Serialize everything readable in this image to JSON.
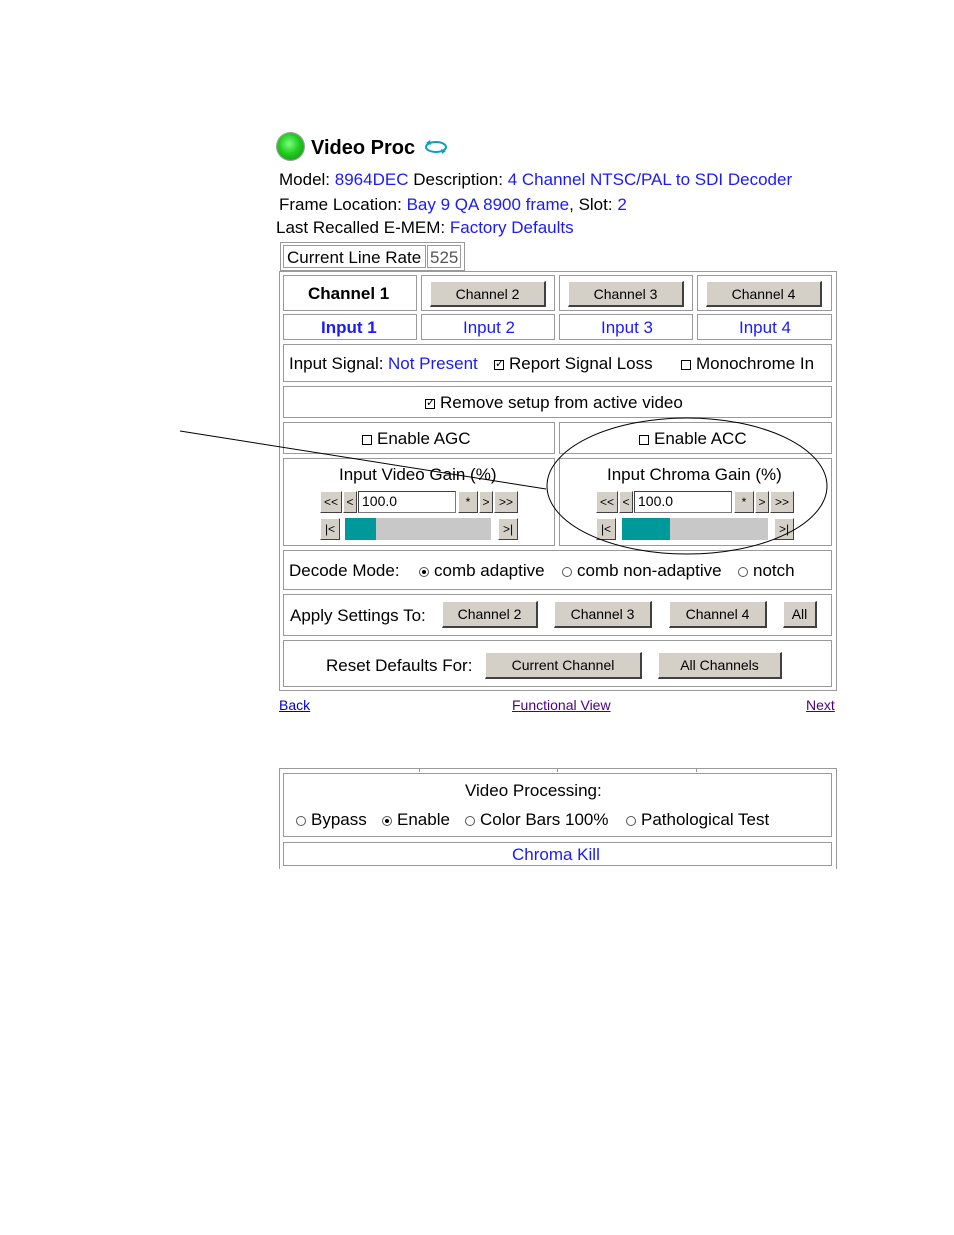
{
  "header": {
    "title": "Video Proc",
    "model_label": "Model:",
    "model_value": "8964DEC",
    "description_label": "Description:",
    "description_value": "4 Channel NTSC/PAL to SDI Decoder",
    "frame_location_label": "Frame Location:",
    "frame_location_value": "Bay 9 QA 8900 frame",
    "slot_label": ", Slot:",
    "slot_value": "2",
    "emem_label": "Last Recalled E-MEM:",
    "emem_value": "Factory Defaults"
  },
  "line_rate": {
    "label": "Current Line Rate",
    "value": "525"
  },
  "channels": {
    "current": "Channel 1",
    "buttons": [
      "Channel 2",
      "Channel 3",
      "Channel 4"
    ]
  },
  "inputs": [
    "Input 1",
    "Input 2",
    "Input 3",
    "Input 4"
  ],
  "input_signal": {
    "label": "Input Signal:",
    "value": "Not Present",
    "report_signal_loss": "Report Signal Loss",
    "report_signal_loss_checked": true,
    "monochrome": "Monochrome In",
    "monochrome_checked": false
  },
  "remove_setup": {
    "label": "Remove setup from active video",
    "checked": true
  },
  "agc": {
    "label": "Enable AGC",
    "checked": false
  },
  "acc": {
    "label": "Enable ACC",
    "checked": false
  },
  "video_gain": {
    "title": "Input Video Gain (%)",
    "value": "100.0",
    "level_fraction": 0.21,
    "btn_ll": "<<",
    "btn_l": "<",
    "btn_star": "*",
    "btn_r": ">",
    "btn_rr": ">>",
    "btn_min": "|<",
    "btn_max": ">|"
  },
  "chroma_gain": {
    "title": "Input Chroma Gain (%)",
    "value": "100.0",
    "level_fraction": 0.33,
    "btn_ll": "<<",
    "btn_l": "<",
    "btn_star": "*",
    "btn_r": ">",
    "btn_rr": ">>",
    "btn_min": "|<",
    "btn_max": ">|"
  },
  "decode_mode": {
    "label": "Decode Mode:",
    "options": [
      "comb adaptive",
      "comb non-adaptive",
      "notch"
    ],
    "selected": "comb adaptive"
  },
  "apply_settings": {
    "label": "Apply Settings To:",
    "buttons": [
      "Channel 2",
      "Channel 3",
      "Channel 4",
      "All"
    ]
  },
  "reset_defaults": {
    "label": "Reset Defaults For:",
    "buttons": [
      "Current Channel",
      "All Channels"
    ]
  },
  "nav": {
    "back": "Back",
    "functional_view": "Functional View",
    "next": "Next"
  },
  "video_processing": {
    "label": "Video Processing:",
    "options": [
      "Bypass",
      "Enable",
      "Color Bars 100%",
      "Pathological Test"
    ],
    "selected": "Enable"
  },
  "chroma_kill": "Chroma Kill",
  "colors": {
    "link_blue": "#1a1aff",
    "status_green": "#22cc22",
    "slider_fill": "#009999",
    "slider_track": "#c8c8c8"
  }
}
